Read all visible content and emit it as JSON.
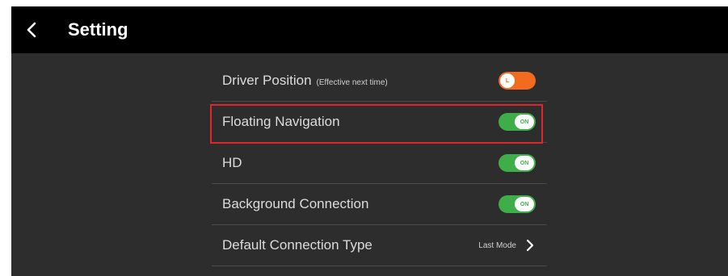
{
  "header": {
    "title": "Setting"
  },
  "settings": [
    {
      "label": "Driver Position",
      "note": "(Effective next time)",
      "control": "toggle",
      "state": "L"
    },
    {
      "label": "Floating Navigation",
      "control": "toggle",
      "state": "ON",
      "highlighted": true
    },
    {
      "label": "HD",
      "control": "toggle",
      "state": "ON"
    },
    {
      "label": "Background Connection",
      "control": "toggle",
      "state": "ON"
    },
    {
      "label": "Default Connection Type",
      "control": "link",
      "value": "Last Mode"
    }
  ],
  "icons": {
    "back": "chevron-left-icon",
    "row_arrow": "chevron-right-icon"
  },
  "colors": {
    "header_bg": "#000000",
    "content_bg": "#2d2d2d",
    "toggle_on": "#3fae49",
    "toggle_orange": "#f26b1f",
    "highlight": "#e0262b"
  }
}
